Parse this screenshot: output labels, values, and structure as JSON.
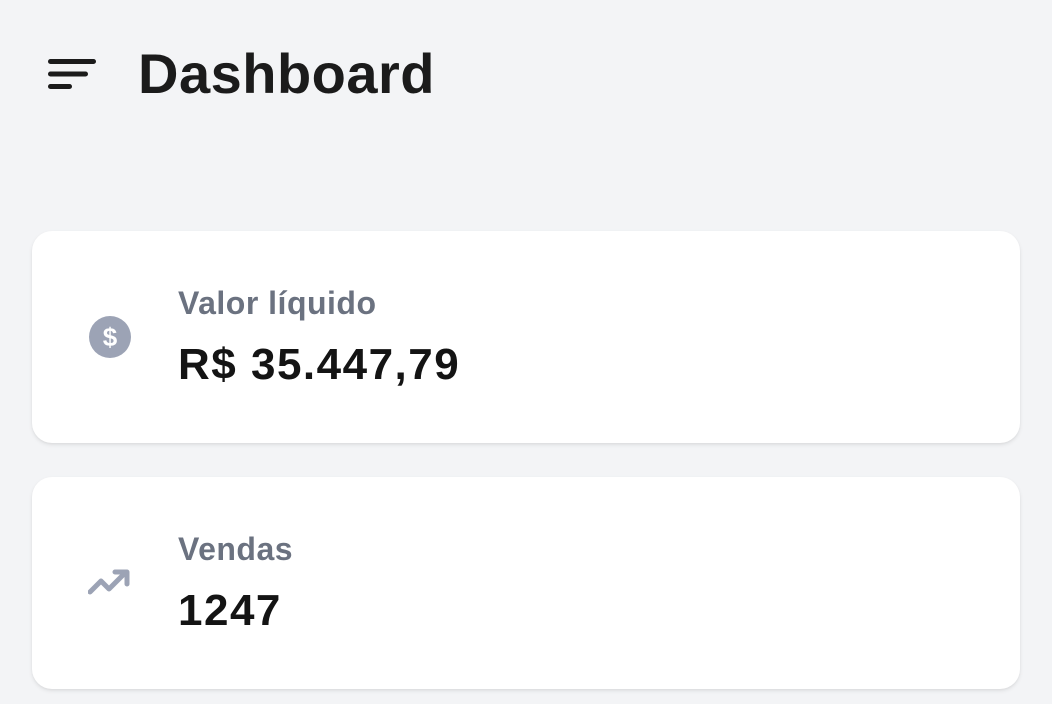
{
  "header": {
    "menu_icon": "menu-icon",
    "title": "Dashboard"
  },
  "cards": [
    {
      "icon": "dollar-coin-icon",
      "label": "Valor líquido",
      "value": "R$ 35.447,79"
    },
    {
      "icon": "trending-up-icon",
      "label": "Vendas",
      "value": "1247"
    }
  ],
  "colors": {
    "background": "#f3f4f6",
    "card": "#ffffff",
    "label": "#6b7280",
    "value": "#141414",
    "icon": "#9ca3b5"
  }
}
